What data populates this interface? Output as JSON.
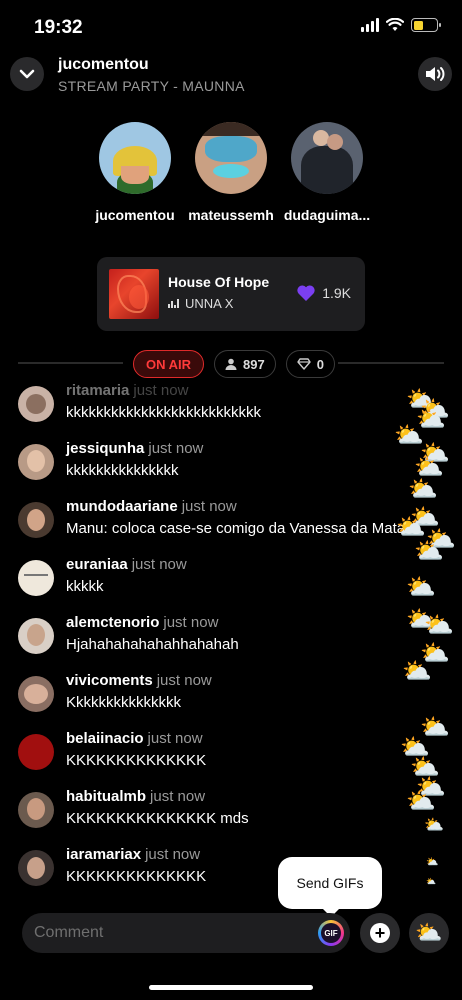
{
  "status_bar": {
    "time": "19:32",
    "battery_level": 0.45,
    "battery_color": "#f7d531"
  },
  "header": {
    "title": "jucomentou",
    "subtitle": "STREAM PARTY - MAUNNA"
  },
  "participants": [
    {
      "name": "jucomentou"
    },
    {
      "name": "mateussemh"
    },
    {
      "name": "dudaguima..."
    }
  ],
  "now_playing": {
    "title": "House Of Hope",
    "artist": "UNNA X",
    "likes": "1.9K",
    "like_color": "#7b3ff2"
  },
  "live": {
    "on_air_label": "ON AIR",
    "listeners": "897",
    "diamonds": "0",
    "accent_color": "#e02a2a"
  },
  "comments": [
    {
      "user": "ritamaria",
      "time": "just now",
      "text": "kkkkkkkkkkkkkkkkkkkkkkkkkk"
    },
    {
      "user": "jessiqunha",
      "time": "just now",
      "text": "kkkkkkkkkkkkkkk"
    },
    {
      "user": "mundodaariane",
      "time": "just now",
      "text": "Manu: coloca case-se comigo da Vanessa da Mata"
    },
    {
      "user": "euraniaa",
      "time": "just now",
      "text": "kkkkk"
    },
    {
      "user": "alemctenorio",
      "time": "just now",
      "text": "Hjahahahahahahhahahah"
    },
    {
      "user": "vivicoments",
      "time": "just now",
      "text": "Kkkkkkkkkkkkkkk"
    },
    {
      "user": "belaiinacio",
      "time": "just now",
      "text": "KKKKKKKKKKKKKK"
    },
    {
      "user": "habitualmb",
      "time": "just now",
      "text": "KKKKKKKKKKKKKKK mds"
    },
    {
      "user": "iaramariax",
      "time": "just now",
      "text": "KKKKKKKKKKKKKK"
    }
  ],
  "tooltip": {
    "text": "Send GIFs"
  },
  "composer": {
    "placeholder": "Comment",
    "gif_label": "GIF",
    "weather_icon_name": "sun-behind-cloud-icon"
  }
}
